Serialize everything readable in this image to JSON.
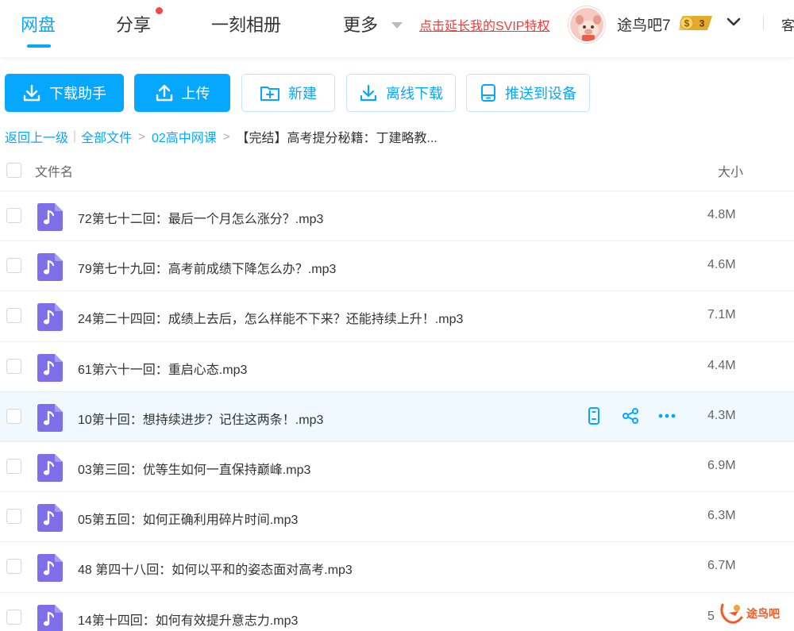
{
  "nav": {
    "tabs": [
      {
        "label": "网盘",
        "active": true
      },
      {
        "label": "分享",
        "has_notification_dot": true
      },
      {
        "label": "一刻相册"
      },
      {
        "label": "更多"
      }
    ],
    "svip_link": "点击延长我的SVIP特权",
    "username": "途鸟吧7",
    "vip_level": "3",
    "vip_symbol": "$",
    "truncated_right": "客"
  },
  "toolbar": {
    "download_helper": "下载助手",
    "upload": "上传",
    "new_folder": "新建",
    "offline_download": "离线下载",
    "push_to_device": "推送到设备"
  },
  "breadcrumb": {
    "back": "返回上一级",
    "all_files": "全部文件",
    "folder": "02高中网课",
    "current": "【完结】高考提分秘籍：丁建略教..."
  },
  "list": {
    "header_name": "文件名",
    "header_size": "大小",
    "files": [
      {
        "name": "72第七十二回：最后一个月怎么涨分？.mp3",
        "size": "4.8M"
      },
      {
        "name": "79第七十九回：高考前成绩下降怎么办？.mp3",
        "size": "4.6M"
      },
      {
        "name": "24第二十四回：成绩上去后，怎么样能不下来？还能持续上升！.mp3",
        "size": "7.1M"
      },
      {
        "name": "61第六十一回：重启心态.mp3",
        "size": "4.4M"
      },
      {
        "name": "10第十回：想持续进步？记住这两条！.mp3",
        "size": "4.3M",
        "hovered": true
      },
      {
        "name": "03第三回：优等生如何一直保持巅峰.mp3",
        "size": "6.9M"
      },
      {
        "name": "05第五回：如何正确利用碎片时间.mp3",
        "size": "6.3M"
      },
      {
        "name": "48 第四十八回：如何以平和的姿态面对高考.mp3",
        "size": "6.7M"
      },
      {
        "name": "14第十四回：如何有效提升意志力.mp3",
        "size": "5"
      }
    ]
  },
  "watermark": {
    "text": "途鸟吧"
  },
  "colors": {
    "accent": "#06a7ff",
    "link_red": "#f23c3c",
    "file_icon": "#7e6ee8",
    "hover_row": "#f0f9ff"
  }
}
